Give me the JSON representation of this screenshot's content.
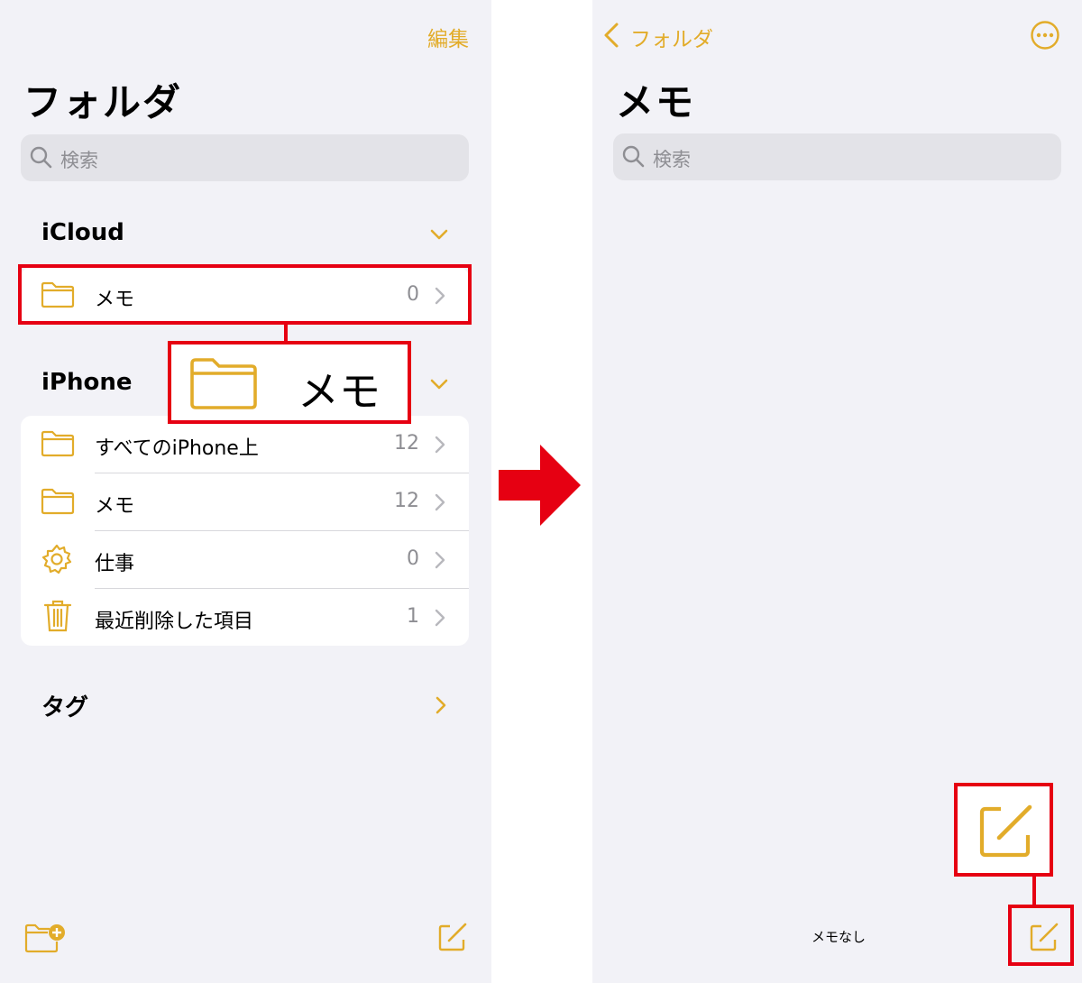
{
  "left": {
    "edit_label": "編集",
    "title": "フォルダ",
    "search_placeholder": "検索",
    "icloud": {
      "header": "iCloud",
      "rows": [
        {
          "label": "メモ",
          "count": "0",
          "icon": "folder-icon"
        }
      ]
    },
    "iphone": {
      "header": "iPhone",
      "rows": [
        {
          "label": "すべてのiPhone上",
          "count": "12",
          "icon": "folder-icon"
        },
        {
          "label": "メモ",
          "count": "12",
          "icon": "folder-icon"
        },
        {
          "label": "仕事",
          "count": "0",
          "icon": "gear-icon"
        },
        {
          "label": "最近削除した項目",
          "count": "1",
          "icon": "trash-icon"
        }
      ]
    },
    "tags_header": "タグ",
    "zoom_label": "メモ"
  },
  "right": {
    "back_label": "フォルダ",
    "title": "メモ",
    "search_placeholder": "検索",
    "empty_label": "メモなし"
  },
  "colors": {
    "accent": "#e2ac2a",
    "highlight": "#e60012",
    "background": "#f2f2f7",
    "arrow": "#e60012"
  }
}
